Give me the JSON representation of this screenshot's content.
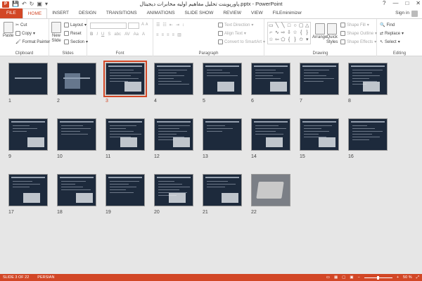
{
  "title_bar": {
    "doc_title": "پاورپوینت تحلیل مفاهیم اولیه مخابرات دیجیتال.pptx - PowerPoint",
    "app_icon": "P",
    "controls": [
      "?",
      "—",
      "□",
      "✕"
    ]
  },
  "tabs": [
    "FILE",
    "HOME",
    "INSERT",
    "DESIGN",
    "TRANSITIONS",
    "ANIMATIONS",
    "SLIDE SHOW",
    "REVIEW",
    "VIEW",
    "FILEminimizer"
  ],
  "active_tab": "HOME",
  "sign_in": "Sign in",
  "ribbon": {
    "clipboard": {
      "label": "Clipboard",
      "paste": "Paste",
      "cut": "Cut",
      "copy": "Copy",
      "format_painter": "Format Painter"
    },
    "slides": {
      "label": "Slides",
      "new_slide": "New",
      "new_slide2": "Slide",
      "layout": "Layout",
      "reset": "Reset",
      "section": "Section"
    },
    "font": {
      "label": "Font"
    },
    "paragraph": {
      "label": "Paragraph",
      "text_direction": "Text Direction",
      "align_text": "Align Text",
      "convert": "Convert to SmartArt"
    },
    "drawing": {
      "label": "Drawing",
      "arrange": "Arrange",
      "quick_styles": "Quick",
      "quick_styles2": "Styles",
      "shape_fill": "Shape Fill",
      "shape_outline": "Shape Outline",
      "shape_effects": "Shape Effects"
    },
    "editing": {
      "label": "Editing",
      "find": "Find",
      "replace": "Replace",
      "select": "Select"
    }
  },
  "slides": [
    {
      "num": "1"
    },
    {
      "num": "2"
    },
    {
      "num": "3"
    },
    {
      "num": "4"
    },
    {
      "num": "5"
    },
    {
      "num": "6"
    },
    {
      "num": "7"
    },
    {
      "num": "8"
    },
    {
      "num": "9"
    },
    {
      "num": "10"
    },
    {
      "num": "11"
    },
    {
      "num": "12"
    },
    {
      "num": "13"
    },
    {
      "num": "14"
    },
    {
      "num": "15"
    },
    {
      "num": "16"
    },
    {
      "num": "17"
    },
    {
      "num": "18"
    },
    {
      "num": "19"
    },
    {
      "num": "20"
    },
    {
      "num": "21"
    },
    {
      "num": "22"
    }
  ],
  "selected_slide": 3,
  "status": {
    "slide_info": "SLIDE 3 OF 22",
    "language": "PERSIAN",
    "zoom": "50 %",
    "zoom_fraction": 0.5
  },
  "colors": {
    "accent": "#d24726",
    "sorter_bg": "#e6e6e6",
    "slide_bg": "#1d2a3c"
  }
}
